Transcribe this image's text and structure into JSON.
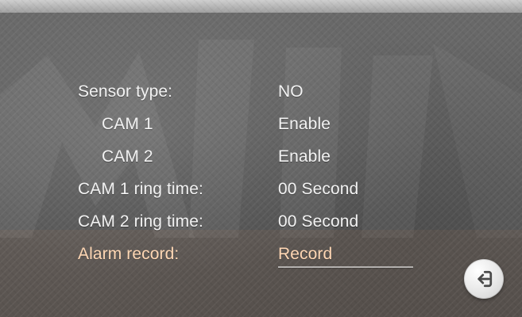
{
  "menu": {
    "items": [
      {
        "label": "Sensor type:",
        "value": "NO"
      },
      {
        "label": "CAM 1",
        "value": "Enable"
      },
      {
        "label": "CAM 2",
        "value": "Enable"
      },
      {
        "label": "CAM 1 ring time:",
        "value": "00 Second"
      },
      {
        "label": "CAM 2 ring time:",
        "value": "00 Second"
      },
      {
        "label": "Alarm record:",
        "value": "Record"
      }
    ]
  },
  "icons": {
    "back": "back-icon"
  },
  "colors": {
    "text": "#f2f2f2",
    "selected_text": "#ffd7b4",
    "background": "#5f5f5f",
    "button": "#e7e7e7",
    "icon": "#4a4a4a"
  }
}
